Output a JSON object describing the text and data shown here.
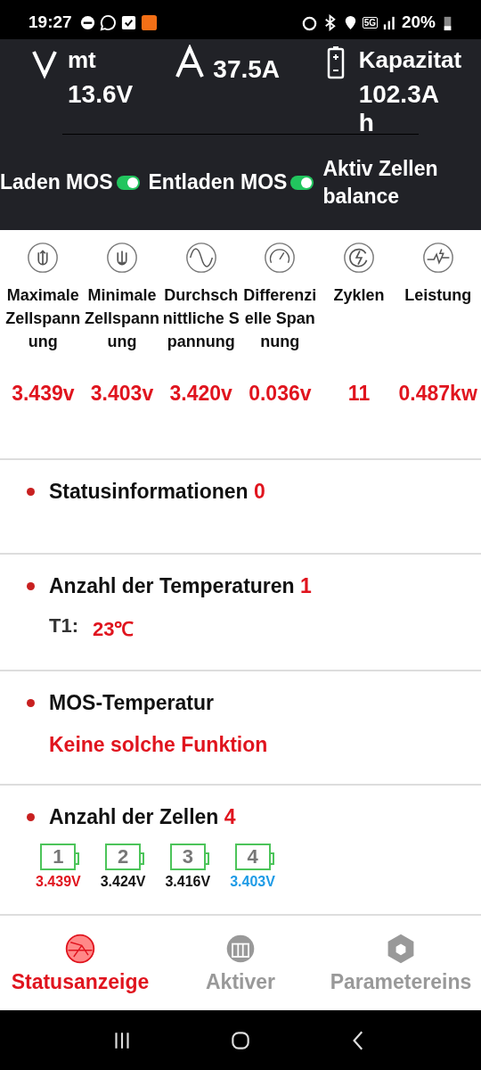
{
  "status_bar": {
    "time": "19:27",
    "network": "5G",
    "battery": "20%"
  },
  "header": {
    "readings": [
      {
        "kind": "volt",
        "label": "mt",
        "value": "13.6V"
      },
      {
        "kind": "amp",
        "value": "37.5A"
      },
      {
        "kind": "battery",
        "label": "Kapazitat",
        "value": "102.3Ah"
      }
    ],
    "switches": [
      {
        "label": "Laden MOS",
        "on": true
      },
      {
        "label": "Entladen MOS",
        "on": true
      }
    ],
    "balance_label": "Aktiv Zellenbalance"
  },
  "metrics": [
    {
      "kind": "max",
      "label": "Maximale Zellspannung",
      "value": "3.439v"
    },
    {
      "kind": "min",
      "label": "Minimale Zellspannung",
      "value": "3.403v"
    },
    {
      "kind": "avg",
      "label": "Durchschnittliche Spannung",
      "value": "3.420v"
    },
    {
      "kind": "diff",
      "label": "Differenzielle Spannung",
      "value": "0.036v"
    },
    {
      "kind": "cycles",
      "label": "Zyklen",
      "value": "11"
    },
    {
      "kind": "power",
      "label": "Leistung",
      "value": "0.487kw"
    }
  ],
  "status_info": {
    "title": "Statusinformationen",
    "count": "0"
  },
  "temperatures": {
    "title": "Anzahl der Temperaturen",
    "count": "1",
    "sensors": [
      {
        "name": "T1:",
        "value": "23℃"
      }
    ]
  },
  "mos_temperature": {
    "title": "MOS-Temperatur",
    "message": "Keine solche Funktion"
  },
  "cells": {
    "title": "Anzahl der Zellen",
    "count": "4",
    "items": [
      {
        "number": "1",
        "voltage": "3.439V",
        "color": "#e0141e"
      },
      {
        "number": "2",
        "voltage": "3.424V",
        "color": "#111111"
      },
      {
        "number": "3",
        "voltage": "3.416V",
        "color": "#111111"
      },
      {
        "number": "4",
        "voltage": "3.403V",
        "color": "#1e9be6"
      }
    ]
  },
  "bottom_nav": [
    {
      "kind": "status",
      "label": "Statusanzeige",
      "selected": true
    },
    {
      "kind": "active",
      "label": "Aktiver",
      "selected": false
    },
    {
      "kind": "params",
      "label": "Parametereins",
      "selected": false
    }
  ]
}
